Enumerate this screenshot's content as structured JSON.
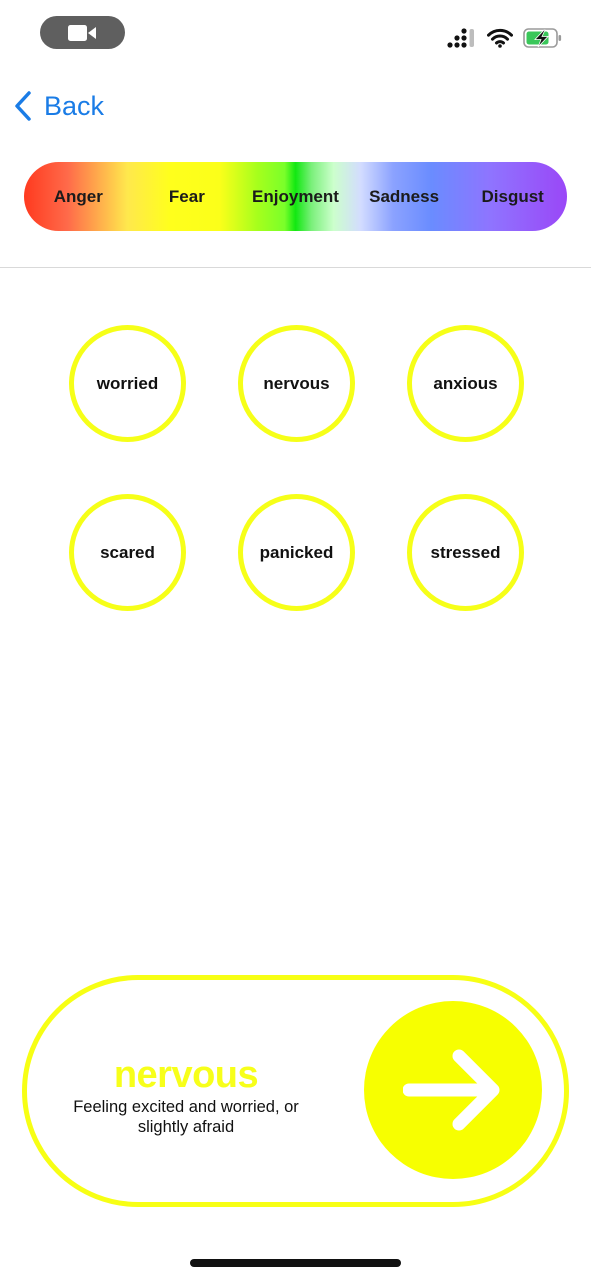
{
  "status_bar": {
    "camera_icon": "video-camera-icon",
    "signal_icon": "cellular-signal-icon",
    "wifi_icon": "wifi-icon",
    "battery_icon": "battery-charging-icon"
  },
  "nav": {
    "back_label": "Back",
    "back_icon": "chevron-left-icon"
  },
  "spectrum": {
    "items": [
      "Anger",
      "Fear",
      "Enjoyment",
      "Sadness",
      "Disgust"
    ]
  },
  "emotions": {
    "accent_color": "#f6ff18",
    "items": [
      "worried",
      "nervous",
      "anxious",
      "scared",
      "panicked",
      "stressed"
    ]
  },
  "selection": {
    "title": "nervous",
    "description": "Feeling excited and worried, or slightly afraid",
    "button_icon": "arrow-right-icon"
  }
}
